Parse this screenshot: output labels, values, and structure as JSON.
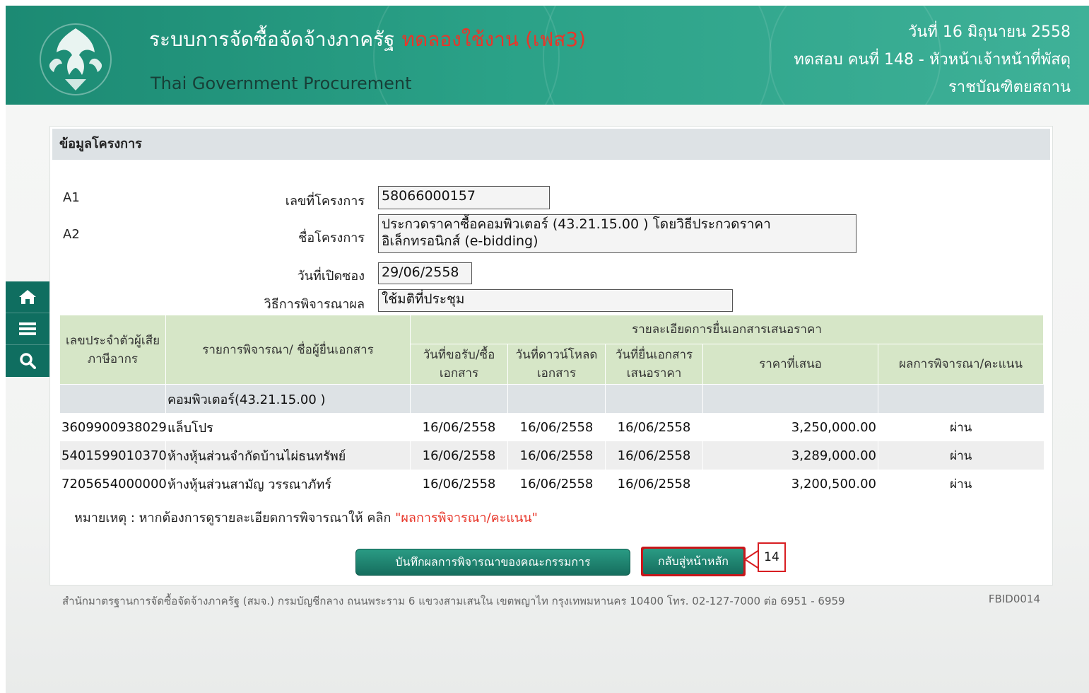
{
  "header": {
    "system_title": "ระบบการจัดซื้อจัดจ้างภาครัฐ",
    "test_label": "ทดลองใช้งาน (เฟส3)",
    "subtitle": "Thai Government Procurement",
    "date": "วันที่ 16 มิถุนายน 2558",
    "user": "ทดสอบ คนที่ 148 - หัวหน้าเจ้าหน้าที่พัสดุ",
    "agency": "ราชบัณฑิตยสถาน"
  },
  "sidebar": {
    "icons": [
      "home-icon",
      "menu-icon",
      "search-icon"
    ]
  },
  "section": {
    "title": "ข้อมูลโครงการ"
  },
  "project": {
    "code_a1": "A1",
    "code_a2": "A2",
    "project_no_label": "เลขที่โครงการ",
    "project_no": "58066000157",
    "project_name_label": "ชื่อโครงการ",
    "project_name_line1": "ประกวดราคาซื้อคอมพิวเตอร์ (43.21.15.00 ) โดยวิธีประกวดราคา",
    "project_name_line2": "อิเล็กทรอนิกส์ (e-bidding)",
    "open_date_label": "วันที่เปิดซอง",
    "open_date": "29/06/2558",
    "method_label": "วิธีการพิจารณาผล",
    "method": "ใช้มติที่ประชุม"
  },
  "table": {
    "headers": {
      "tax_id": "เลขประจำตัวผู้เสียภาษีอากร",
      "item": "รายการพิจารณา/ ชื่อผู้ยื่นเอกสาร",
      "detail_group": "รายละเอียดการยื่นเอกสารเสนอราคา",
      "request_date": "วันที่ขอรับ/ซื้อ เอกสาร",
      "download_date": "วันที่ดาวน์โหลด เอกสาร",
      "submit_date": "วันที่ยื่นเอกสาร เสนอราคา",
      "price": "ราคาที่เสนอ",
      "result": "ผลการพิจารณา/คะแนน"
    },
    "group_label": "คอมพิวเตอร์(43.21.15.00 )",
    "rows": [
      {
        "tax_id": "3609900938029",
        "name": "แล็บโปร",
        "request_date": "16/06/2558",
        "download_date": "16/06/2558",
        "submit_date": "16/06/2558",
        "price": "3,250,000.00",
        "result": "ผ่าน"
      },
      {
        "tax_id": "5401599010370",
        "name": "ห้างหุ้นส่วนจำกัดบ้านไผ่ธนทรัพย์",
        "request_date": "16/06/2558",
        "download_date": "16/06/2558",
        "submit_date": "16/06/2558",
        "price": "3,289,000.00",
        "result": "ผ่าน"
      },
      {
        "tax_id": "7205654000000",
        "name": "ห้างหุ้นส่วนสามัญ วรรณาภัทร์",
        "request_date": "16/06/2558",
        "download_date": "16/06/2558",
        "submit_date": "16/06/2558",
        "price": "3,200,500.00",
        "result": "ผ่าน"
      }
    ]
  },
  "note": {
    "text": "หมายเหตุ : หากต้องการดูรายละเอียดการพิจารณาให้ คลิก",
    "link": "\"ผลการพิจารณา/คะแนน\""
  },
  "buttons": {
    "save": "บันทึกผลการพิจารณาของคณะกรรมการ",
    "back": "กลับสู่หน้าหลัก"
  },
  "callout": {
    "number": "14"
  },
  "footer": {
    "text": "สำนักมาตรฐานการจัดซื้อจัดจ้างภาครัฐ (สมจ.) กรมบัญชีกลาง ถนนพระราม 6 แขวงสามเสนใน เขตพญาไท กรุงเทพมหานคร 10400 โทร. 02-127-7000 ต่อ 6951 - 6959",
    "code": "FBID0014"
  },
  "colors": {
    "header_green": "#2aa187",
    "table_header": "#d6e6c7",
    "highlight_red": "#d81e22",
    "link_blue": "#3a9bd5"
  }
}
